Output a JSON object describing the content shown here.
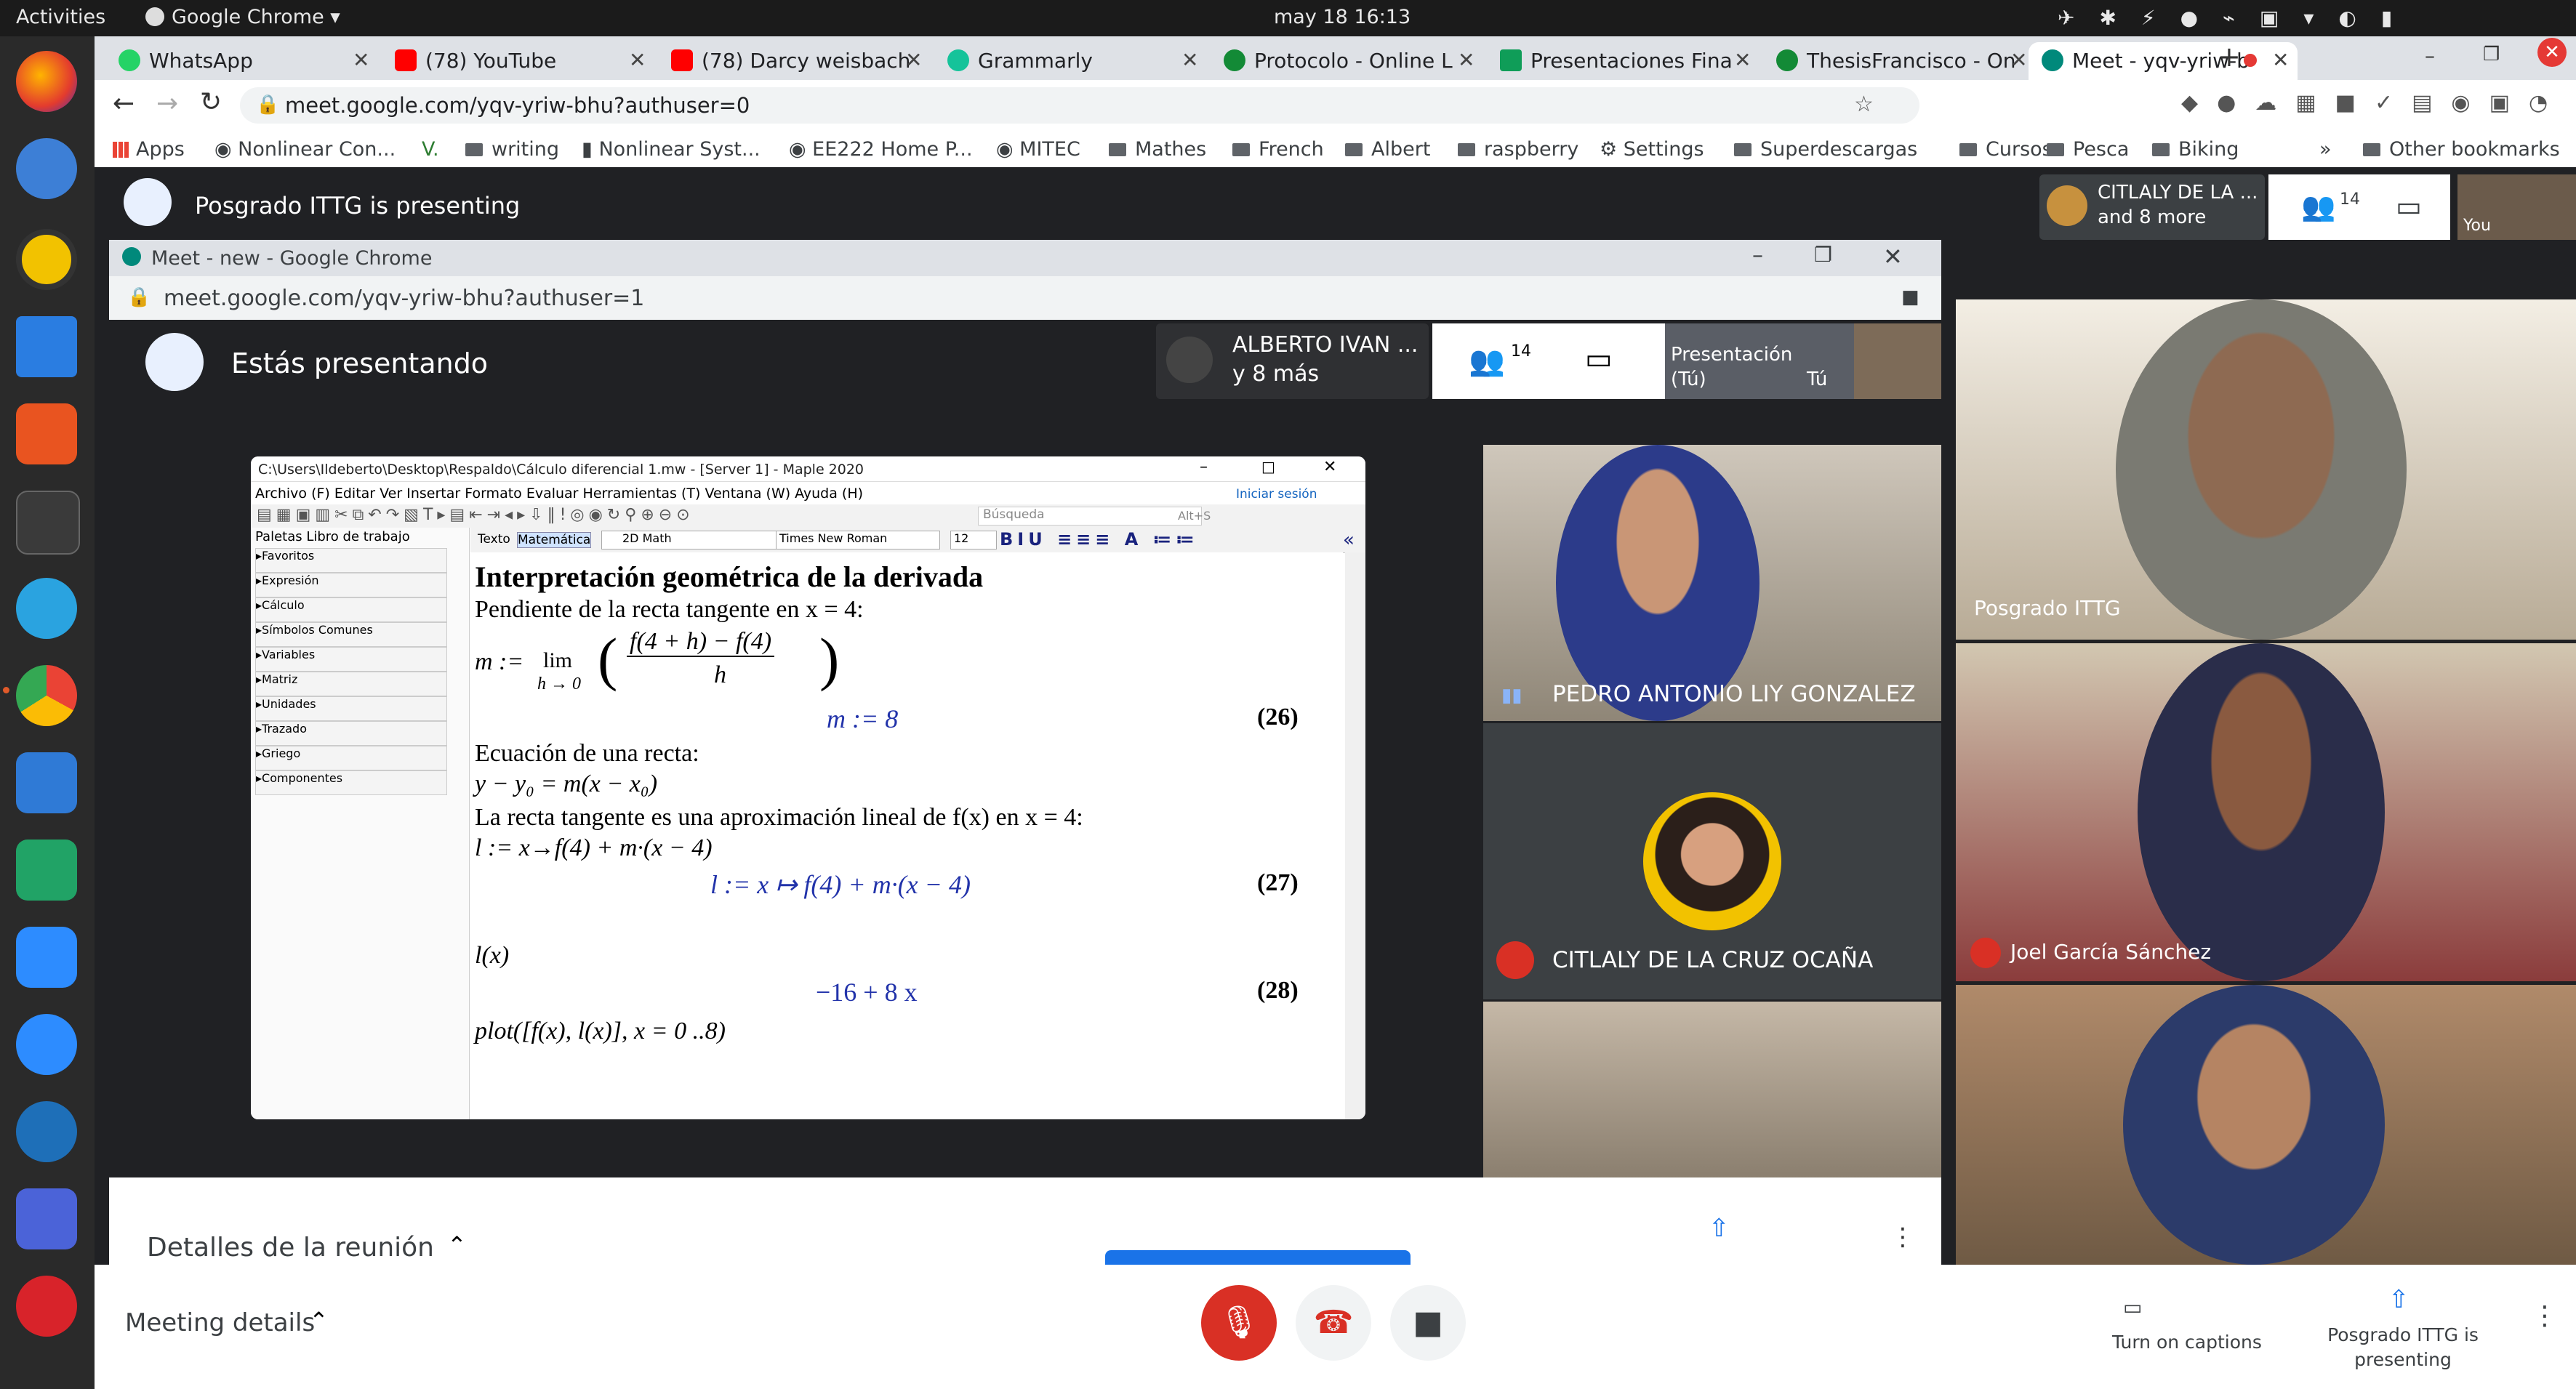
{
  "topbar": {
    "activities": "Activities",
    "app": "Google Chrome",
    "clock": "may 18  16:13"
  },
  "tabs": [
    {
      "label": "WhatsApp",
      "color": "#25d366"
    },
    {
      "label": "(78) YouTube",
      "color": "#ff0000"
    },
    {
      "label": "(78) Darcy weisbach",
      "color": "#ff0000"
    },
    {
      "label": "Grammarly",
      "color": "#15c39a"
    },
    {
      "label": "Protocolo - Online L",
      "color": "#138a36"
    },
    {
      "label": "Presentaciones Fina",
      "color": "#0f9d58"
    },
    {
      "label": "ThesisFrancisco - On",
      "color": "#138a36"
    },
    {
      "label": "Meet - yqv-yriw-b",
      "color": "#00897b"
    }
  ],
  "omnibox": {
    "url": "meet.google.com/yqv-yriw-bhu?authuser=0"
  },
  "bookmarks": [
    "Apps",
    "Nonlinear Con...",
    "writing",
    "Nonlinear Syst...",
    "EE222 Home P...",
    "MITEC",
    "Mathes",
    "French",
    "Albert",
    "raspberry",
    "Settings",
    "Superdescargas",
    "Cursos",
    "Pesca",
    "Biking",
    "Other bookmarks"
  ],
  "meet": {
    "presenting_banner": "Posgrado ITTG is presenting",
    "participants_chip": "CITLALY DE LA ...",
    "participants_more": "and 8 more",
    "participant_count": "14",
    "you_label": "You",
    "tiles": [
      {
        "name": "Posgrado ITTG"
      },
      {
        "name": "Joel García Sánchez"
      },
      {
        "name": ""
      }
    ],
    "meeting_details": "Meeting details",
    "captions": "Turn on captions",
    "presenting_status": "Posgrado ITTG is presenting"
  },
  "inner": {
    "title": "Meet - new - Google Chrome",
    "url": "meet.google.com/yqv-yriw-bhu?authuser=1",
    "presenting": "Estás presentando",
    "chip_name": "ALBERTO IVAN ...",
    "chip_more": "y 8 más",
    "count": "14",
    "presentation_label": "Presentación",
    "presentation_sub": "(Tú)",
    "you": "Tú",
    "tile1": "PEDRO ANTONIO LIY GONZALEZ",
    "tile2": "CITLALY DE LA CRUZ OCAÑA",
    "details": "Detalles de la reunión"
  },
  "maple": {
    "title": "C:\\Users\\Ildeberto\\Desktop\\Respaldo\\Cálculo diferencial 1.mw - [Server 1] - Maple 2020",
    "menu": "Archivo (F)  Editar  Ver  Insertar  Formato  Evaluar  Herramientas (T)  Ventana (W)  Ayuda (H)",
    "signin": "Iniciar sesión",
    "search_placeholder": "Búsqueda",
    "search_shortcut": "Alt+S",
    "palette_header": "Paletas  Libro de trabajo",
    "palettes": [
      "Favoritos",
      "Expresión",
      "Cálculo",
      "Símbolos Comunes",
      "Variables",
      "Matriz",
      "Unidades",
      "Trazado",
      "Griego",
      "Componentes"
    ],
    "fmt_text": "Texto",
    "fmt_math": "Matemática",
    "fmt_mode": "2D Math",
    "fmt_font": "Times New Roman",
    "fmt_size": "12",
    "heading": "Interpretación geométrica de la derivada",
    "line1": "Pendiente de la recta tangente en x = 4:",
    "m_def": "m :=",
    "lim": "lim",
    "lim_sub": "h → 0",
    "numer": "f(4 + h) − f(4)",
    "denom": "h",
    "out26": "m := 8",
    "eq26": "(26)",
    "line2": "Ecuación de una recta:",
    "line3": "y − y₀ = m(x − x₀)",
    "line4": "La recta tangente es una aproximación lineal de f(x) en x = 4:",
    "line5": "l := x→f(4) + m·(x − 4)",
    "out27": "l := x ↦ f(4) + m·(x − 4)",
    "eq27": "(27)",
    "line6": "l(x)",
    "out28": "−16 + 8 x",
    "eq28": "(28)",
    "line7": "plot([f(x), l(x)], x = 0 ..8)"
  }
}
